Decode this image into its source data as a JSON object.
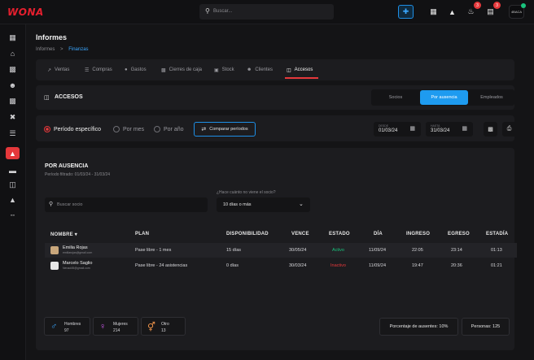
{
  "app": {
    "logo": "WONA"
  },
  "search": {
    "placeholder": "Buscar..."
  },
  "topbar": {
    "notifications_badge": "3",
    "cards_badge": "3",
    "user_avatar": "4BACA"
  },
  "sidebar": {
    "icons": [
      "dashboard-icon",
      "home-icon",
      "chart-icon",
      "users-icon",
      "building-icon",
      "tools-icon",
      "report-icon",
      "card-icon",
      "access-icon",
      "graduation-icon",
      "dumbbell-icon"
    ]
  },
  "header": {
    "title": "Informes",
    "breadcrumb_1": "Informes",
    "breadcrumb_sep": ">",
    "breadcrumb_2": "Finanzas"
  },
  "tabs": [
    {
      "label": "Ventas"
    },
    {
      "label": "Compras"
    },
    {
      "label": "Gastos"
    },
    {
      "label": "Cierres de caja"
    },
    {
      "label": "Stock"
    },
    {
      "label": "Clientes"
    },
    {
      "label": "Accesos"
    }
  ],
  "access": {
    "title": "ACCESOS",
    "segments": [
      "Socios",
      "Por ausencia",
      "Empleados"
    ],
    "active_segment": "Por ausencia"
  },
  "period": {
    "options": [
      "Período específico",
      "Por mes",
      "Por año"
    ],
    "selected": "Período específico",
    "compare_label": "Comparar períodos",
    "from_label": "DESDE",
    "from_value": "01/03/24",
    "to_label": "HASTA",
    "to_value": "31/03/24"
  },
  "report": {
    "title": "POR AUSENCIA",
    "filter_text": "Período filtrado: 01/03/24 - 31/03/24",
    "search_placeholder": "Buscar socio",
    "question": "¿Hace cuánto no viene el socio?",
    "select_value": "10 días o más"
  },
  "table": {
    "headers": [
      "NOMBRE",
      "PLAN",
      "DISPONIBILIDAD",
      "VENCE",
      "ESTADO",
      "DÍA",
      "INGRESO",
      "EGRESO",
      "ESTADÍA"
    ],
    "rows": [
      {
        "name": "Emilia Rojas",
        "email": "emiliarojas@gmail.com",
        "plan": "Pase libre - 1 mes",
        "availability": "15 días",
        "expires": "30/05/24",
        "status": "Activo",
        "day": "11/09/24",
        "in": "22:05",
        "out": "23:14",
        "stay": "01:13"
      },
      {
        "name": "Marcelo Saglio",
        "email": "Nenad45@gmail.com",
        "plan": "Pase libre - 24 asistencias",
        "availability": "0 días",
        "expires": "30/03/24",
        "status": "Inactivo",
        "day": "11/09/24",
        "in": "19:47",
        "out": "20:36",
        "stay": "01:21"
      }
    ]
  },
  "stats": {
    "men_label": "Hombres",
    "men_value": "97",
    "women_label": "Mujeres",
    "women_value": "214",
    "other_label": "Otro",
    "other_value": "13",
    "absent_pct": "Porcentaje de ausentes: 10%",
    "people": "Personas: 125"
  },
  "colors": {
    "accent_red": "#e5383b",
    "accent_blue": "#1e9bf0",
    "active_green": "#19c37d",
    "inactive_red": "#e5383b"
  }
}
